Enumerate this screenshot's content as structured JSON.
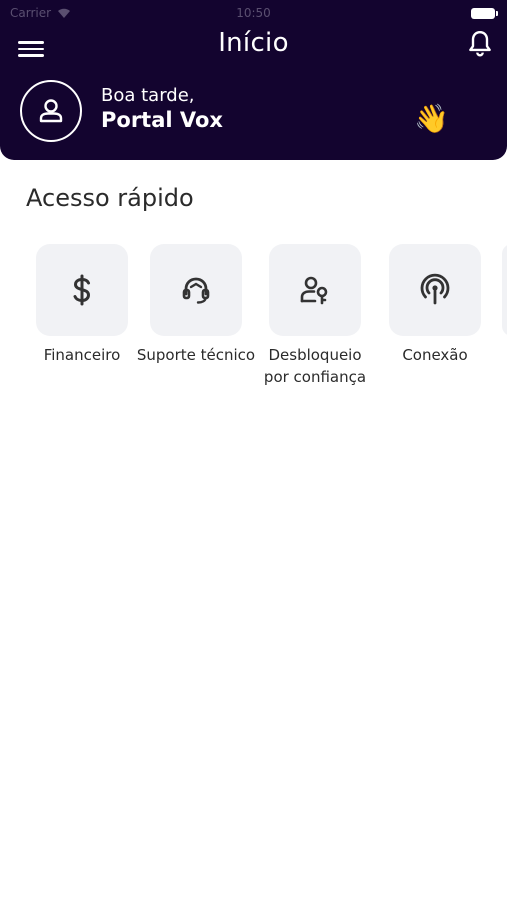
{
  "status_bar": {
    "carrier": "Carrier",
    "time": "10:50"
  },
  "header": {
    "title": "Início",
    "greeting": "Boa tarde,",
    "user_name": "Portal Vox",
    "wave_emoji": "👋"
  },
  "quick_access": {
    "title": "Acesso rápido",
    "items": [
      {
        "label": "Financeiro",
        "icon": "dollar-icon"
      },
      {
        "label": "Suporte técnico",
        "icon": "headset-icon"
      },
      {
        "label": "Desbloqueio por confiança",
        "icon": "user-key-icon"
      },
      {
        "label": "Conexão",
        "icon": "signal-icon"
      }
    ]
  },
  "colors": {
    "header_bg": "#13042f",
    "card_bg": "#f1f2f5",
    "icon": "#333333"
  }
}
